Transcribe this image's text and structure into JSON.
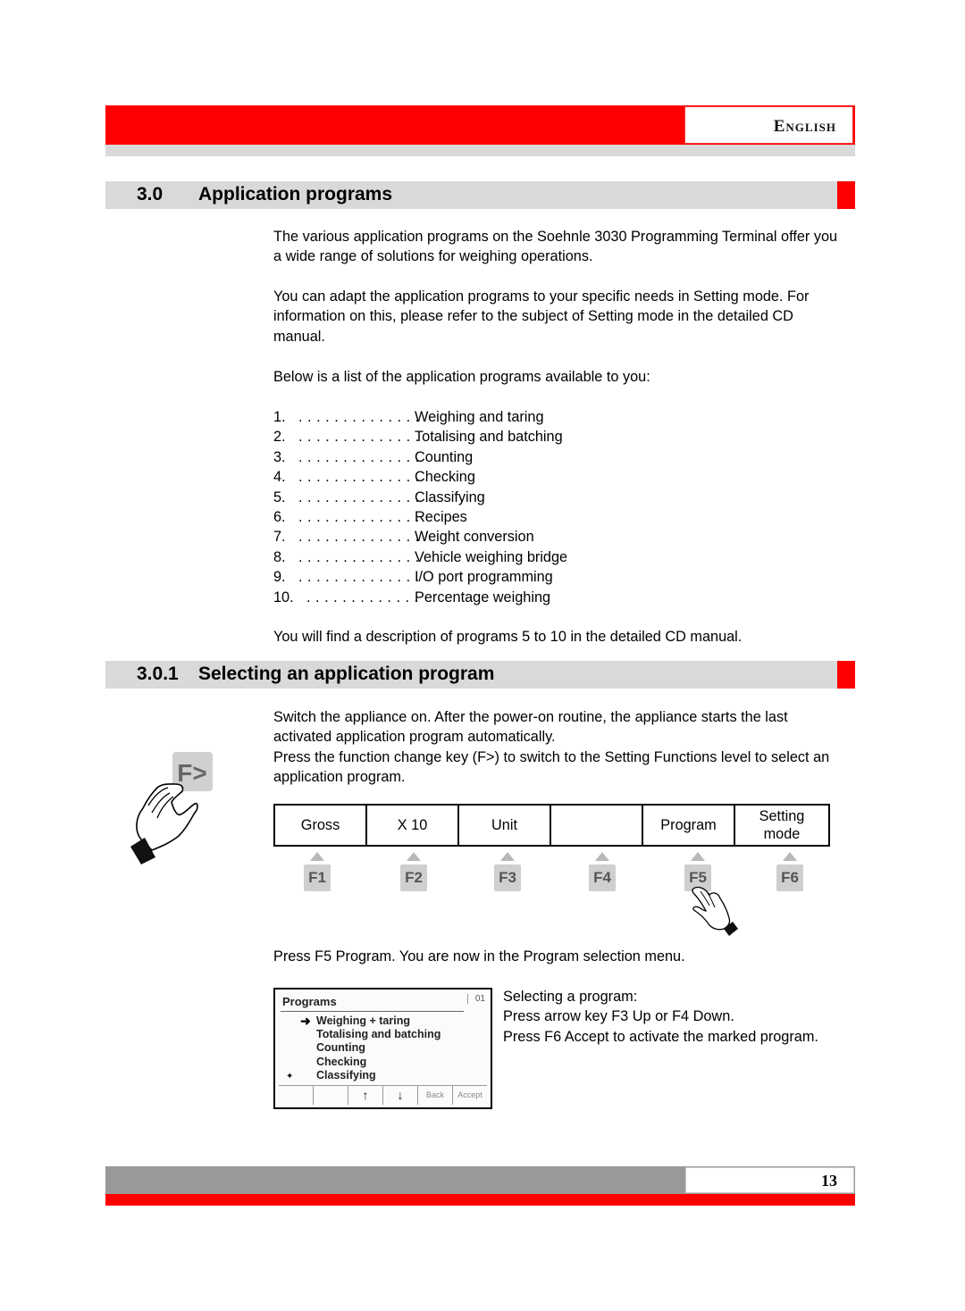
{
  "header": {
    "language": "English",
    "accent_color": "#ff0000",
    "band_gray": "#d9d9d9"
  },
  "section_main": {
    "number": "3.0",
    "title": "Application programs",
    "paragraphs": [
      "The various application programs on the Soehnle 3030 Programming Terminal offer you a wide range of solutions for weighing operations.",
      "You can adapt the application programs to your specific needs in Setting mode. For information on this, please refer to the subject of Setting mode in the detailed CD manual.",
      "Below is a list of the application programs available to you:"
    ],
    "programs": [
      {
        "num": "1.",
        "dots": ". . . . . . . . . . . . . .",
        "label": "Weighing and taring"
      },
      {
        "num": "2.",
        "dots": ". . . . . . . . . . . . . .",
        "label": "Totalising and batching"
      },
      {
        "num": "3.",
        "dots": ". . . . . . . . . . . . . .",
        "label": "Counting"
      },
      {
        "num": "4.",
        "dots": ". . . . . . . . . . . . . .",
        "label": "Checking"
      },
      {
        "num": "5.",
        "dots": ". . . . . . . . . . . . . .",
        "label": "Classifying"
      },
      {
        "num": "6.",
        "dots": ". . . . . . . . . . . . . .",
        "label": "Recipes"
      },
      {
        "num": "7.",
        "dots": ". . . . . . . . . . . . . .",
        "label": "Weight conversion"
      },
      {
        "num": "8.",
        "dots": ". . . . . . . . . . . . . .",
        "label": "Vehicle weighing bridge"
      },
      {
        "num": "9.",
        "dots": ". . . . . . . . . . . . . .",
        "label": "I/O port programming"
      },
      {
        "num": "10.",
        "dots": ". . . . . . . . . . . . .",
        "label": "Percentage weighing"
      }
    ],
    "note": "You will find a description of programs 5 to 10 in the detailed CD manual."
  },
  "section_sub": {
    "number": "3.0.1",
    "title": "Selecting an application program",
    "paragraph1": "Switch the appliance on. After the power-on routine, the appliance starts the last activated application program automatically.",
    "paragraph2": "Press the function change key (F>) to switch to the Setting Functions level to select an application program.",
    "fkey_icon_label": "F>",
    "function_table": [
      "Gross",
      "X 10",
      "Unit",
      "",
      "Program",
      "Setting mode"
    ],
    "function_keys": [
      "F1",
      "F2",
      "F3",
      "F4",
      "F5",
      "F6"
    ],
    "pressed_key": "F5",
    "instruction": "Press F5 Program. You are now in the Program selection menu.",
    "screen": {
      "title": "Programs",
      "page": "01",
      "selected_arrow": "➜",
      "items": [
        "Weighing + taring",
        "Totalising and batching",
        "Counting",
        "Checking",
        "Classifying"
      ],
      "more_indicator": "✦",
      "softkeys": [
        "",
        "",
        "↑",
        "↓",
        "Back",
        "Accept"
      ]
    },
    "selecting_text": [
      "Selecting a program:",
      "Press arrow key F3 Up or F4 Down.",
      "Press F6 Accept to activate the marked program."
    ]
  },
  "footer": {
    "page_number": "13"
  }
}
